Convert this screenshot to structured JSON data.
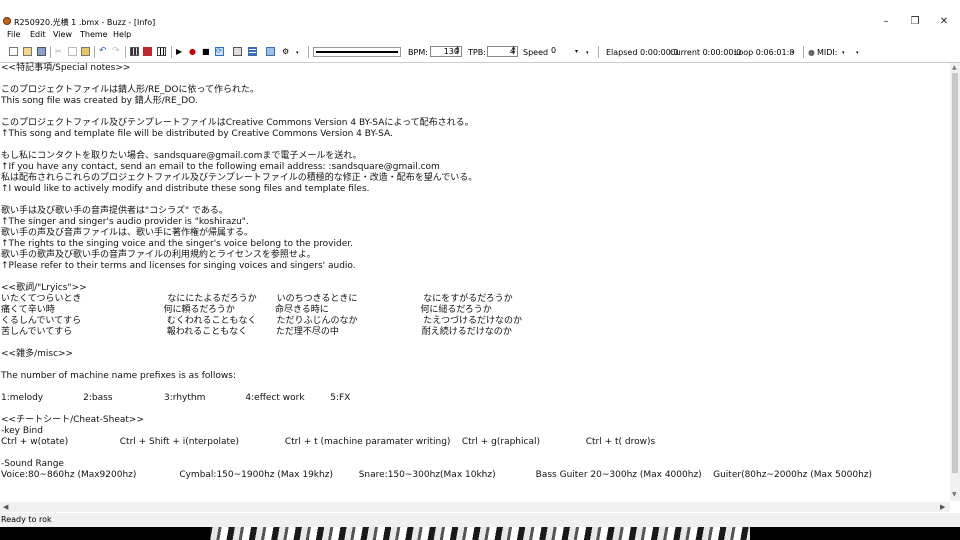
{
  "window": {
    "title": "R250920.光横 1 .bmx - Buzz - [Info]",
    "minimize": "–",
    "maximize": "❐",
    "close": "✕"
  },
  "menu": [
    "File",
    "Edit",
    "View",
    "Theme",
    "Help"
  ],
  "toolbar": {
    "bpm_label": "BPM:",
    "bpm_value": "130",
    "tpb_label": "TPB:",
    "tpb_value": "4",
    "speed_label": "Speed:",
    "speed_value": "0",
    "elapsed": "Elapsed 0:00:00:0",
    "current": "Current 0:00:00:0",
    "loop": "Loop 0:06:01:8",
    "midi_label": "MIDI:"
  },
  "lines": [
    "<<特記事項/Special notes>>",
    "",
    "このプロジェクトファイルは錆人形/RE_DOに依って作られた。",
    "This song file was created by 錆人形/RE_DO.",
    "",
    "このプロジェクトファイル及びテンプレートファイルはCreative Commons Version 4 BY-SAによって配布される。",
    "↑This song and template file will be distributed by Creative Commons Version 4 BY-SA.",
    "",
    "もし私にコンタクトを取りたい場合、sandsquare@gmail.comまで電子メールを送れ。",
    "↑If you have any contact, send an email to the following email address: :sandsquare@gmail.com",
    "私は配布されらこれらのプロジェクトファイル及びテンプレートファイルの積極的な修正・改造・配布を望んでいる。",
    "↑I would like to actively modify and distribute these song files and template files.",
    "",
    "歌い手は及び歌い手の音声提供者は\"コシラズ\" である。",
    "↑The singer and singer's audio provider is \"koshirazu\".",
    "歌い手の声及び音声ファイルは、歌い手に著作権が帰属する。",
    "↑The rights to the singing voice and the singer's voice belong to the provider.",
    "歌い手の歌声及び歌い手の音声ファイルの利用規約とライセンスを参照せよ。",
    "↑Please refer to their terms and licenses for singing voices and singers' audio.",
    "",
    "<<歌詞/\"Lryics\">>",
    "いたくてつらいとき                              なににたよるだろうか       いのちつきるときに                       なにをすがるだろうか",
    "痛くて辛い時                                      何に頼るだろうか              命尽きる時に                                何に縋るだろうか",
    "くるしんでいてすら                              むくわれることもなく       ただりふじんのなか                       たえつづけるだけなのか",
    "苦しんでいてすら                                 報われることもなく          ただ理不尽の中                             耐え続けるだけなのか",
    "",
    "<<雑多/misc>>",
    "",
    "The number of machine name prefixes is as follows:",
    "",
    "1:melody              2:bass                  3:rhythm              4:effect work         5:FX",
    "",
    "<<チートシート/Cheat-Sheat>>",
    "-key Bind",
    "Ctrl + w(otate)                  Ctrl + Shift + i(nterpolate)                Ctrl + t (machine paramater writing)    Ctrl + g(raphical)                Ctrl + t( drow)s",
    "",
    "-Sound Range",
    "Voice:80~860hz (Max9200hz)               Cymbal:150~1900hz (Max 19khz)         Snare:150~300hz(Max 10khz)              Bass Guiter 20~300hz (Max 4000hz)    Guiter(80hz~2000hz (Max 5000hz)"
  ],
  "status": "Ready to rok"
}
